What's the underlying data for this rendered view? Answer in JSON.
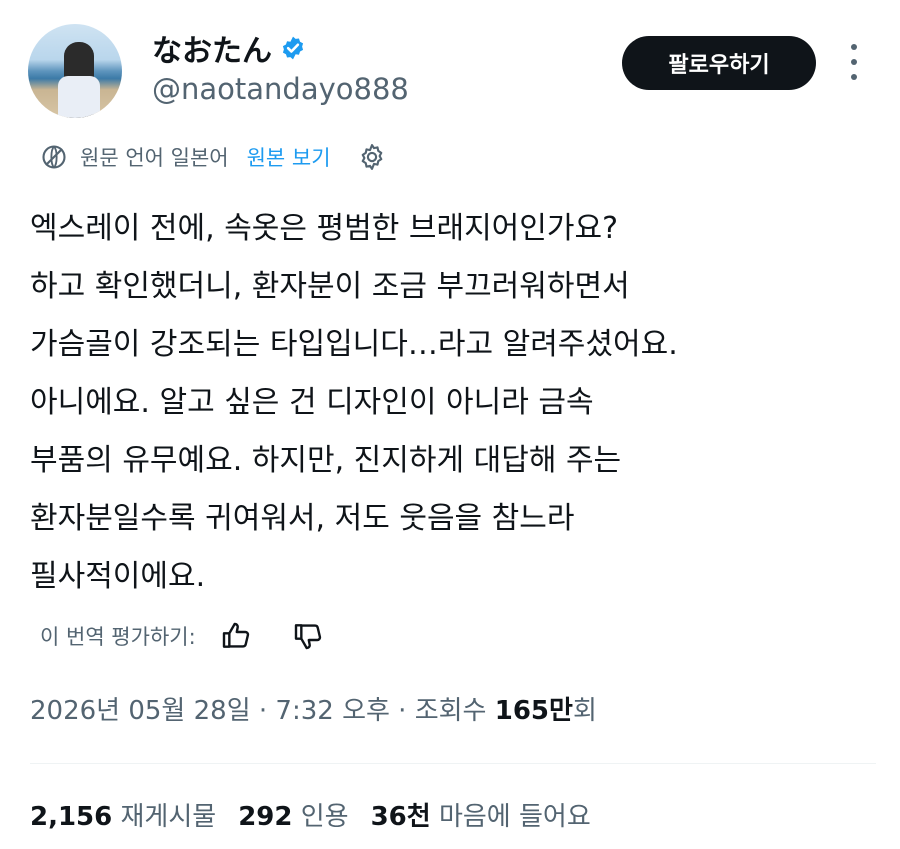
{
  "header": {
    "display_name": "なおたん",
    "handle": "@naotandayo888",
    "follow_label": "팔로우하기"
  },
  "translation": {
    "source_language": "원문 언어 일본어",
    "view_original": "원본 보기"
  },
  "tweet": {
    "lines": [
      "엑스레이 전에, 속옷은 평범한 브래지어인가요?",
      "하고 확인했더니, 환자분이 조금 부끄러워하면서",
      "가슴골이 강조되는 타입입니다…라고 알려주셨어요.",
      "아니에요. 알고 싶은 건 디자인이 아니라 금속",
      "부품의 유무예요. 하지만, 진지하게 대답해 주는",
      "환자분일수록 귀여워서, 저도 웃음을 참느라",
      "필사적이에요."
    ]
  },
  "rating": {
    "label": "이 번역 평가하기:"
  },
  "meta": {
    "timestamp": "2026년 05월 28일 · 7:32 오후 · 조회수 ",
    "views_number": "165만",
    "views_suffix": "회"
  },
  "stats": {
    "reposts_count": "2,156",
    "reposts_label": "재게시물",
    "quotes_count": "292",
    "quotes_label": "인용",
    "likes_count": "36천",
    "likes_label": "마음에 들어요"
  },
  "colors": {
    "text": "#0f1419",
    "secondary": "#536471",
    "link": "#1d9bf0",
    "verified": "#1d9bf0"
  }
}
